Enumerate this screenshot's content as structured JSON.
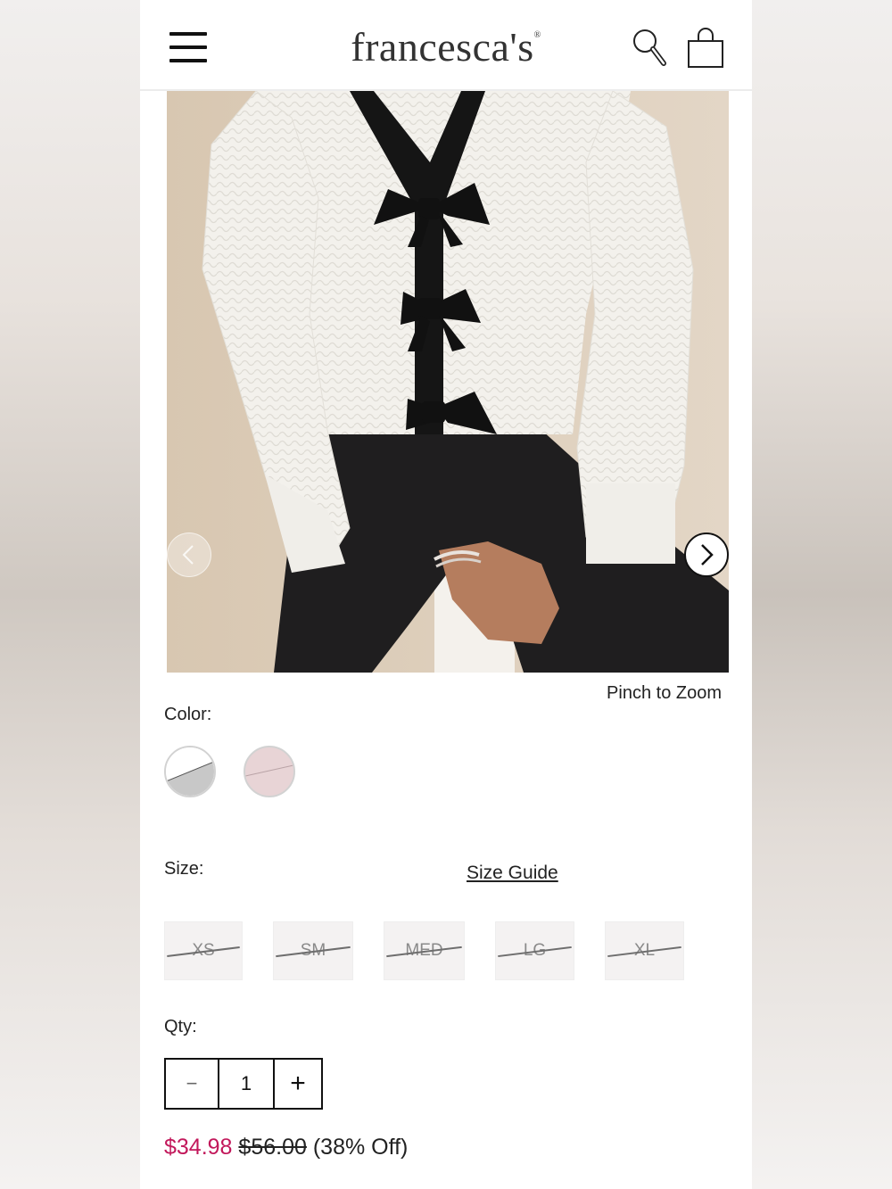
{
  "header": {
    "brand": "francesca's",
    "menu_icon": "hamburger-menu-icon",
    "search_icon": "search-icon",
    "bag_icon": "shopping-bag-icon"
  },
  "gallery": {
    "prev_icon": "chevron-left-icon",
    "next_icon": "chevron-right-icon",
    "pinch_hint": "Pinch to Zoom"
  },
  "color": {
    "label": "Color:",
    "swatches": [
      {
        "name": "white-black",
        "colors": [
          "#ffffff",
          "#c9c9c9"
        ]
      },
      {
        "name": "blush",
        "colors": [
          "#e7d3d5"
        ]
      }
    ]
  },
  "size": {
    "label": "Size:",
    "guide_link": "Size Guide",
    "options": [
      "XS",
      "SM",
      "MED",
      "LG",
      "XL"
    ]
  },
  "quantity": {
    "label": "Qty:",
    "minus": "−",
    "value": "1",
    "plus": "+"
  },
  "price": {
    "sale": "$34.98",
    "original": "$56.00",
    "discount": "(38% Off)",
    "sale_color": "#c2185b"
  }
}
